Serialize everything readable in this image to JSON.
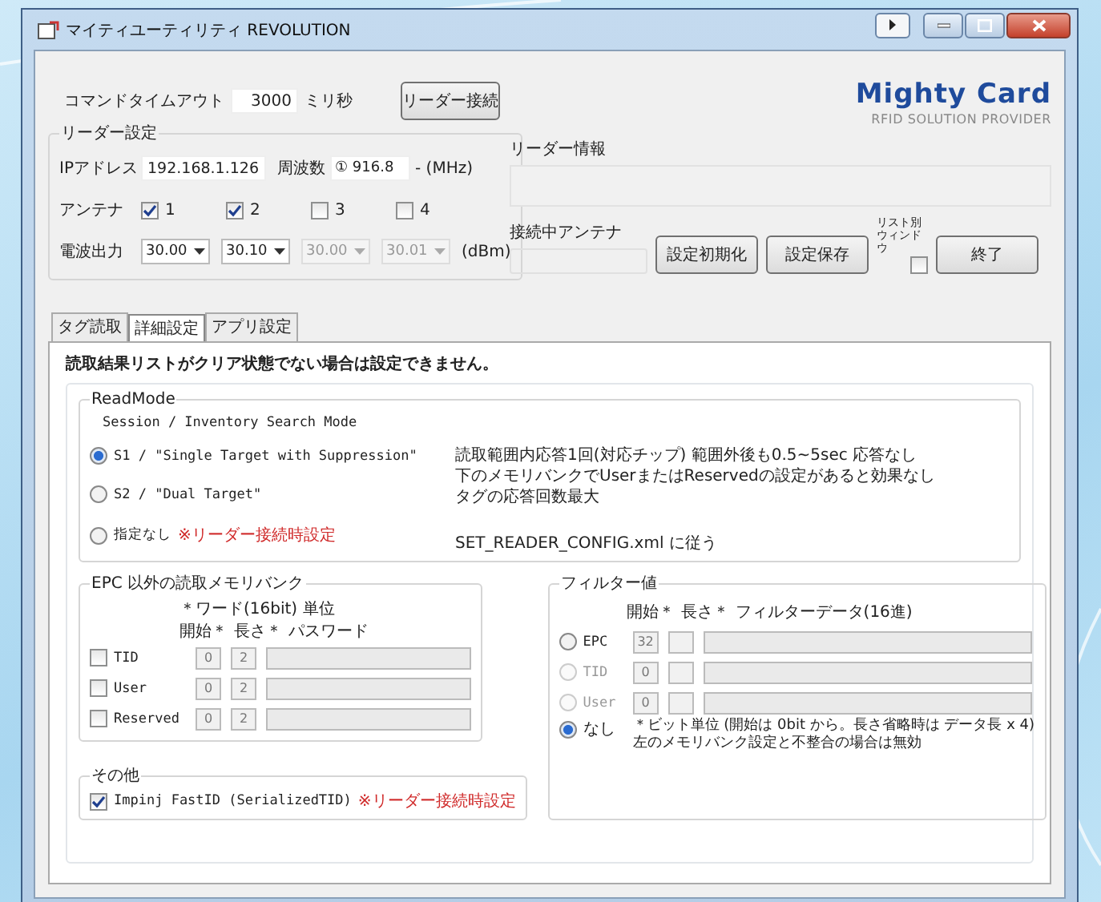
{
  "window": {
    "title": "マイティユーティリティ REVOLUTION"
  },
  "command_timeout": {
    "label": "コマンドタイムアウト",
    "value": "3000",
    "unit": "ミリ秒"
  },
  "connect_button": "リーダー接続",
  "logo": {
    "name": "Mighty Card",
    "tagline": "RFID SOLUTION PROVIDER"
  },
  "reader_settings": {
    "title": "リーダー設定",
    "ip_label": "IPアドレス",
    "ip": "192.168.1.126",
    "freq_label": "周波数",
    "freq_value": "① 916.8",
    "freq_unit": "- (MHz)",
    "antenna_label": "アンテナ",
    "antennas": [
      {
        "label": "1",
        "checked": true
      },
      {
        "label": "2",
        "checked": true
      },
      {
        "label": "3",
        "checked": false
      },
      {
        "label": "4",
        "checked": false
      }
    ],
    "power_label": "電波出力",
    "powers": [
      {
        "value": "30.00",
        "disabled": false
      },
      {
        "value": "30.10",
        "disabled": false
      },
      {
        "value": "30.00",
        "disabled": true
      },
      {
        "value": "30.01",
        "disabled": true
      }
    ],
    "power_unit": "(dBm)"
  },
  "reader_info": {
    "label": "リーダー情報"
  },
  "connected_antenna": {
    "label": "接続中アンテナ"
  },
  "buttons": [
    "設定初期化",
    "設定保存"
  ],
  "list_window": {
    "label": "リスト別ウィンドウ",
    "checked": false
  },
  "exit_button": "終了",
  "tabs": [
    {
      "label": "タグ読取",
      "selected": false
    },
    {
      "label": "詳細設定",
      "selected": true
    },
    {
      "label": "アプリ設定",
      "selected": false
    }
  ],
  "warning": "読取結果リストがクリア状態でない場合は設定できません。",
  "read_mode": {
    "title": "ReadMode",
    "subtitle": "Session / Inventory Search Mode",
    "options": [
      {
        "label": "S1 / \"Single Target with Suppression\"",
        "selected": true
      },
      {
        "label": "S2 / \"Dual Target\"",
        "selected": false
      },
      {
        "label": "指定なし",
        "note": "※リーダー接続時設定",
        "selected": false
      }
    ],
    "description": [
      "読取範囲内応答1回(対応チップ) 範囲外後も0.5~5sec 応答なし",
      "下のメモリバンクでUserまたはReservedの設定があると効果なし",
      "タグの応答回数最大"
    ],
    "config_note": "SET_READER_CONFIG.xml に従う"
  },
  "memory_bank": {
    "title": "EPC 以外の読取メモリバンク",
    "unit_note": "＊ワード(16bit) 単位",
    "headers": [
      "開始＊",
      "長さ＊",
      "パスワード"
    ],
    "rows": [
      {
        "label": "TID",
        "checked": false,
        "start": "0",
        "length": "2"
      },
      {
        "label": "User",
        "checked": false,
        "start": "0",
        "length": "2"
      },
      {
        "label": "Reserved",
        "checked": false,
        "start": "0",
        "length": "2"
      }
    ]
  },
  "other": {
    "title": "その他",
    "label": "Impinj FastID (SerializedTID)",
    "note": "※リーダー接続時設定",
    "checked": true
  },
  "filter": {
    "title": "フィルター値",
    "headers": [
      "開始＊",
      "長さ＊",
      "フィルターデータ(16進)"
    ],
    "rows": [
      {
        "label": "EPC",
        "selected": false,
        "disabled": false,
        "start": "32"
      },
      {
        "label": "TID",
        "selected": false,
        "disabled": true,
        "start": "0"
      },
      {
        "label": "User",
        "selected": false,
        "disabled": true,
        "start": "0"
      }
    ],
    "none_option": {
      "label": "なし",
      "selected": true
    },
    "note": [
      "＊ビット単位 (開始は 0bit から。長さ省略時は データ長 x 4)",
      "左のメモリバンク設定と不整合の場合は無効"
    ]
  }
}
